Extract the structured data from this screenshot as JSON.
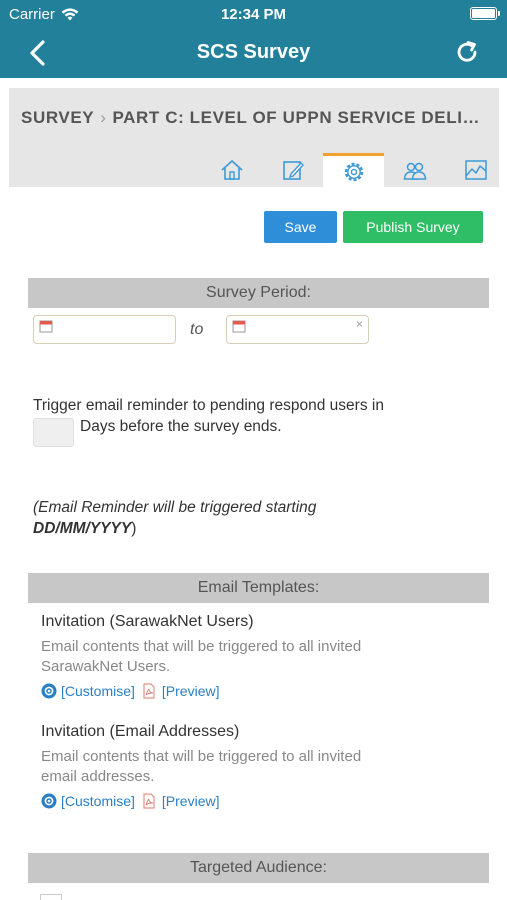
{
  "status": {
    "carrier": "Carrier",
    "time": "12:34 PM"
  },
  "nav": {
    "title": "SCS Survey"
  },
  "breadcrumb": {
    "root": "SURVEY",
    "current": "PART C: LEVEL OF UPPN SERVICE DELIVERY"
  },
  "tabs": [
    {
      "icon": "home-icon"
    },
    {
      "icon": "edit-icon"
    },
    {
      "icon": "settings-icon",
      "active": true
    },
    {
      "icon": "users-icon"
    },
    {
      "icon": "chart-icon"
    }
  ],
  "actions": {
    "save": "Save",
    "publish": "Publish Survey"
  },
  "survey_period": {
    "heading": "Survey Period:",
    "to": "to",
    "start": "",
    "end": ""
  },
  "reminder": {
    "line1": "Trigger email reminder to pending respond users in",
    "line2": "Days before the survey ends.",
    "days": "",
    "note_prefix": "(Email Reminder will be triggered starting",
    "note_date": "DD/MM/YYYY",
    "note_suffix": ")"
  },
  "email_templates": {
    "heading": "Email Templates:",
    "items": [
      {
        "title": "Invitation (SarawakNet Users)",
        "desc1": "Email contents that will be triggered to all invited",
        "desc2": "SarawakNet Users.",
        "customise": "[Customise]",
        "preview": "[Preview]"
      },
      {
        "title": "Invitation (Email Addresses)",
        "desc1": "Email contents that will be triggered to all invited",
        "desc2": "email addresses.",
        "customise": "[Customise]",
        "preview": "[Preview]"
      }
    ]
  },
  "targeted_audience": {
    "heading": "Targeted Audience:"
  },
  "colors": {
    "nav": "#23809a",
    "save": "#2f8ed8",
    "publish": "#2fbd66",
    "link": "#2a7fc4",
    "active_tab": "#f0a030"
  }
}
